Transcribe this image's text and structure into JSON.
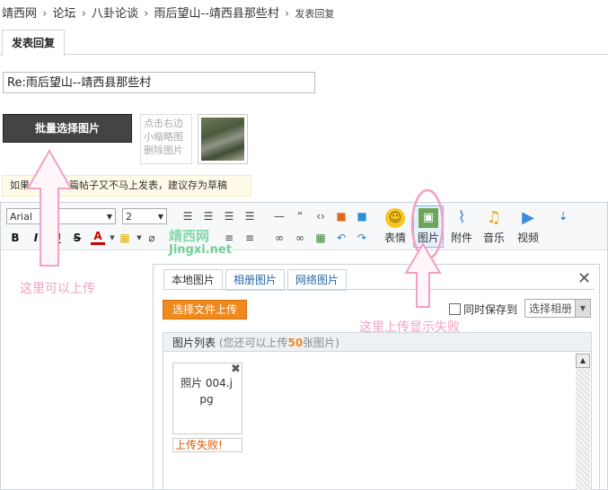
{
  "breadcrumb": {
    "items": [
      "靖西网",
      "论坛",
      "八卦论谈",
      "雨后望山--靖西县那些村"
    ],
    "separator": "›",
    "current": "发表回复"
  },
  "tab": {
    "label": "发表回复"
  },
  "subject": {
    "value": "Re:雨后望山--靖西县那些村"
  },
  "batch_button": {
    "label": "批量选择图片"
  },
  "thumb_hint": {
    "line1": "点击右边",
    "line2": "小缩略图",
    "line3": "删除图片"
  },
  "draft_tip": {
    "text": "如果您在写长篇帖子又不马上发表，建议存为草稿"
  },
  "toolbar": {
    "font_family": "Arial",
    "font_size": "2",
    "bold": "B",
    "italic": "I",
    "underline": "U",
    "strike": "S",
    "text_color": "A",
    "emoji_label": "表情",
    "image_label": "图片",
    "attach_label": "附件",
    "music_label": "音乐",
    "video_label": "视频"
  },
  "dialog": {
    "tabs": [
      "本地图片",
      "相册图片",
      "网络图片"
    ],
    "upload_button": "选择文件上传",
    "save_to_album_label": "同时保存到",
    "album_select": "选择相册",
    "list_title": "图片列表",
    "list_note_prefix": "(您还可以上传",
    "list_note_count": "50",
    "list_note_suffix": "张图片)",
    "file_name": "照片 004.jpg",
    "file_status": "上传失败!"
  },
  "annotations": {
    "left": "这里可以上传",
    "right": "这里上传显示失败"
  },
  "watermark": {
    "cn": "靖西网",
    "en": "Jingxi.net"
  },
  "colors": {
    "annotation": "#f3a0c4",
    "upload_button": "#f08a1c",
    "fail_text": "#e05a00",
    "link": "#2468a8"
  }
}
